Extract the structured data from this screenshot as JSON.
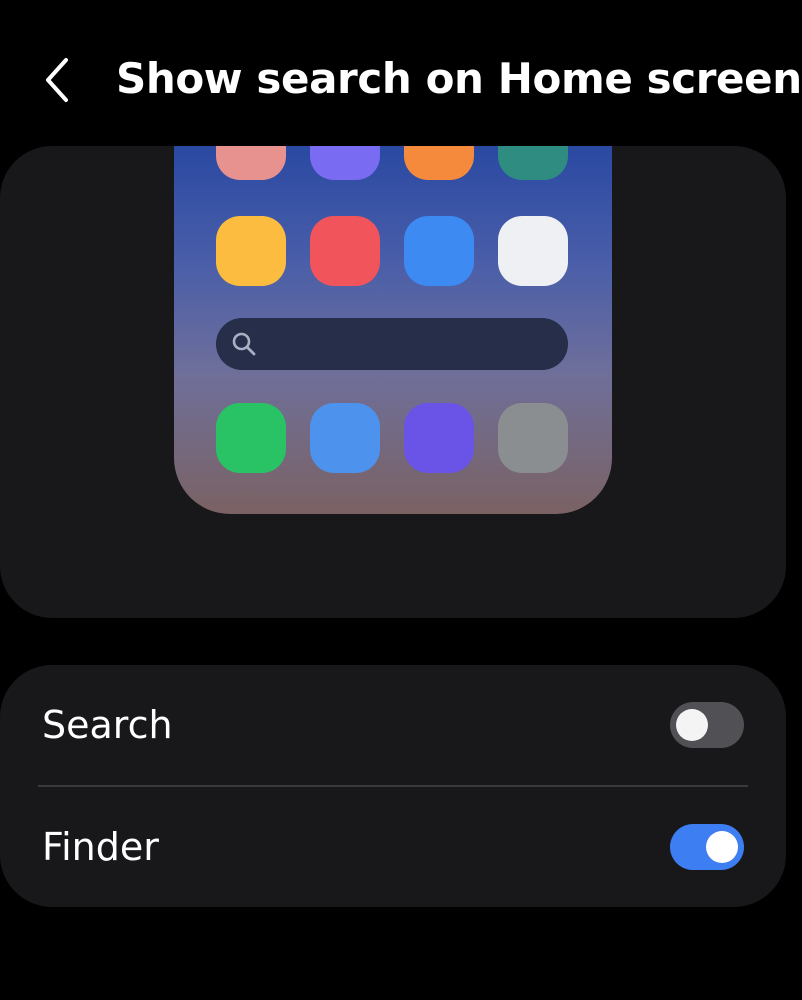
{
  "header": {
    "title": "Show search on Home screen",
    "back_icon": "chevron-left-icon"
  },
  "preview": {
    "app_rows": [
      [
        "#e8928f",
        "#7a6cf2",
        "#f58a3c",
        "#2f8c80"
      ],
      [
        "#fbbc3f",
        "#f2545b",
        "#3c8af2",
        "#eef0f4"
      ],
      [
        "#29c366",
        "#4d92ec",
        "#6a54e8",
        "#8a8e90"
      ]
    ],
    "search_bar": {
      "icon": "search-icon",
      "background": "#262e4a"
    },
    "gradient": [
      "#2a49a2",
      "#4a5ea9",
      "#6f6f9a",
      "#7a6263"
    ]
  },
  "settings": {
    "items": [
      {
        "label": "Search",
        "enabled": false
      },
      {
        "label": "Finder",
        "enabled": true
      }
    ]
  },
  "colors": {
    "background": "#000000",
    "card": "#18181b",
    "toggle_on": "#3d7ef2",
    "toggle_off": "#505055",
    "divider": "#3a3a3e"
  }
}
